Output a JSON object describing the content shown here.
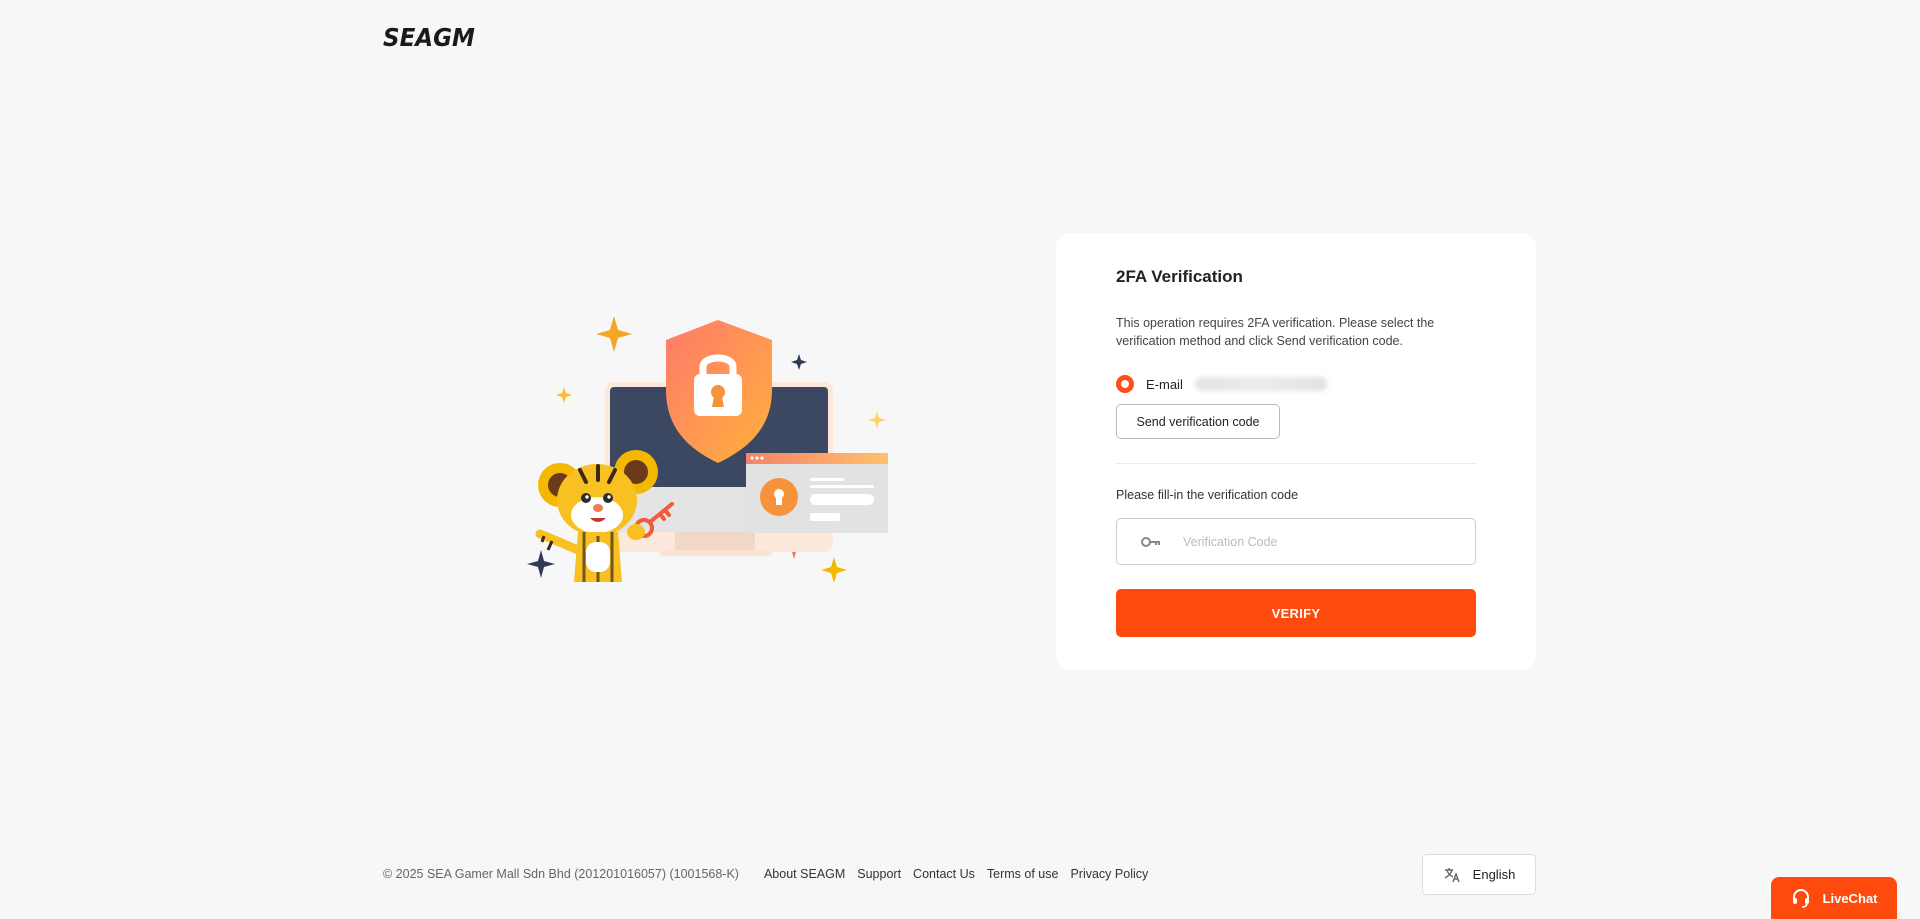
{
  "header": {
    "logo_text": "SEAGM"
  },
  "card": {
    "title": "2FA Verification",
    "description": "This operation requires 2FA verification. Please select the verification method and click Send verification code.",
    "method_label": "E-mail",
    "send_button": "Send verification code",
    "fill_label": "Please fill-in the verification code",
    "code_placeholder": "Verification Code",
    "verify_button": "VERIFY"
  },
  "footer": {
    "copyright": "© 2025 SEA Gamer Mall Sdn Bhd (201201016057) (1001568-K)",
    "links": [
      "About SEAGM",
      "Support",
      "Contact Us",
      "Terms of use",
      "Privacy Policy"
    ]
  },
  "language": {
    "label": "English",
    "icon": "translate-icon"
  },
  "livechat": {
    "label": "LiveChat",
    "icon": "headset-icon"
  },
  "colors": {
    "accent": "#ff4a0d",
    "background": "#f7f7f7"
  }
}
